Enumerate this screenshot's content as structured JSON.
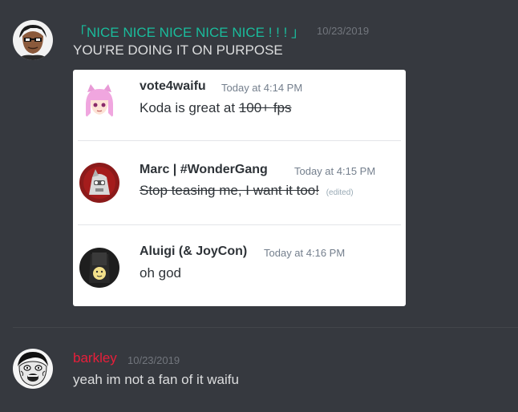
{
  "colors": {
    "background": "#36393f",
    "username_1": "#1abc9c",
    "username_2": "#e91e3a",
    "embed_background": "#ffffff"
  },
  "messages": [
    {
      "username": "「NICE NICE NICE NICE NICE ! ! ! 」",
      "timestamp": "10/23/2019",
      "text": "YOU'RE DOING IT ON PURPOSE",
      "avatar_icon": "cartoon-avatar-icon",
      "embed": {
        "items": [
          {
            "username": "vote4waifu",
            "timestamp": "Today at 4:14 PM",
            "text_plain": "Koda is great at",
            "text_struck": "100+ fps",
            "avatar_icon": "anime-avatar-icon"
          },
          {
            "username": "Marc | #WonderGang",
            "timestamp": "Today at 4:15 PM",
            "text_struck": "Stop teasing me, I want it too!",
            "edited": "(edited)",
            "avatar_icon": "robot-avatar-icon"
          },
          {
            "username": "Aluigi (& JoyCon)",
            "timestamp": "Today at 4:16 PM",
            "text": "oh god",
            "avatar_icon": "joycon-avatar-icon"
          }
        ]
      }
    },
    {
      "username": "barkley",
      "timestamp": "10/23/2019",
      "text": "yeah im not a fan of it waifu",
      "avatar_icon": "meme-face-avatar-icon"
    }
  ]
}
